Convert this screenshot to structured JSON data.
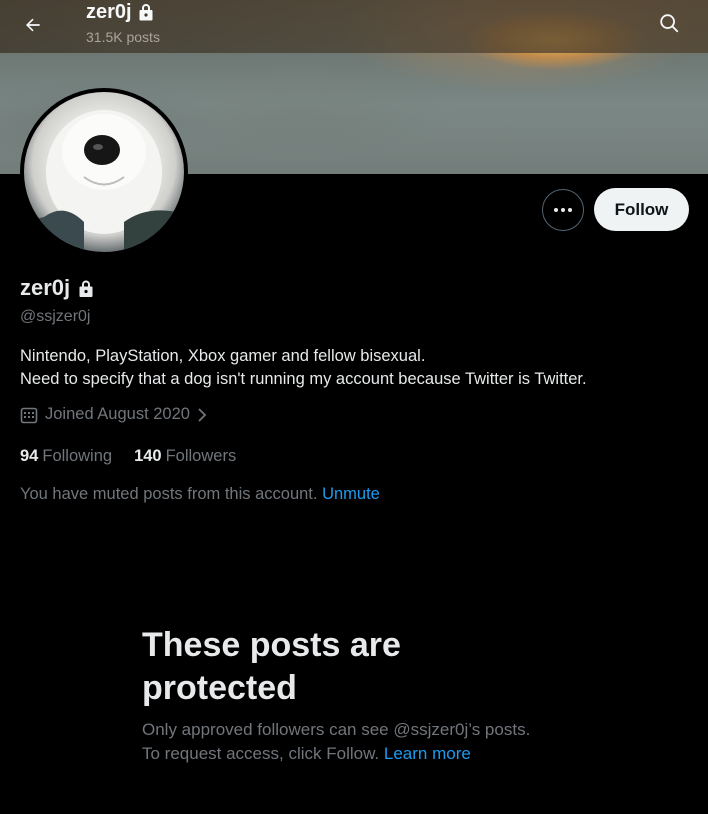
{
  "header": {
    "title": "zer0j",
    "posts_count": "31.5K posts"
  },
  "profile": {
    "display_name": "zer0j",
    "handle": "@ssjzer0j",
    "bio_line1": "Nintendo, PlayStation, Xbox gamer and fellow bisexual.",
    "bio_line2": "Need to specify that a dog isn't running my account because Twitter is Twitter.",
    "joined": "Joined August 2020",
    "following_count": "94",
    "following_label": "Following",
    "followers_count": "140",
    "followers_label": "Followers",
    "muted_text": "You have muted posts from this account.",
    "unmute_label": "Unmute"
  },
  "actions": {
    "follow_label": "Follow"
  },
  "protected": {
    "title": "These posts are protected",
    "desc_line1": "Only approved followers can see @ssjzer0j’s posts.",
    "desc_line2_prefix": "To request access, click Follow.",
    "learn_more": "Learn more"
  },
  "icons": {
    "back": "arrow-left-icon",
    "search": "search-icon",
    "lock": "lock-icon",
    "more": "more-dots-icon",
    "calendar": "calendar-icon",
    "chevron": "chevron-right-icon"
  },
  "colors": {
    "background": "#000000",
    "text_primary": "#e7e9ea",
    "text_secondary": "#71767b",
    "link": "#1d9bf0",
    "follow_button_bg": "#eff3f4"
  }
}
